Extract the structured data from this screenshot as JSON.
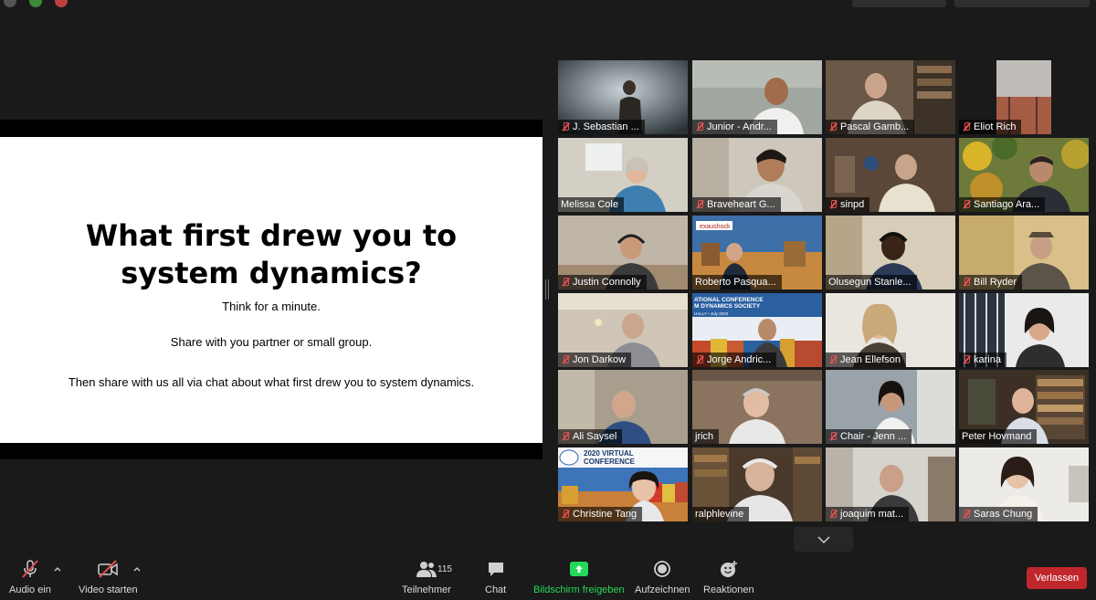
{
  "slide": {
    "title_line1": "What first drew you to",
    "title_line2": "system dynamics?",
    "line1": "Think for a minute.",
    "line2": "Share with you partner or small group.",
    "line3": "Then share with us all via chat about what first drew you to system dynamics."
  },
  "gallery": {
    "participants": [
      {
        "name": "J. Sebastian ...",
        "muted": true
      },
      {
        "name": "Junior - Andr...",
        "muted": true
      },
      {
        "name": "Pascal Gamb...",
        "muted": true
      },
      {
        "name": "Eliot Rich",
        "muted": true
      },
      {
        "name": "Melissa Cole",
        "muted": false
      },
      {
        "name": "Braveheart G...",
        "muted": true
      },
      {
        "name": "sinpd",
        "muted": true
      },
      {
        "name": "Santiago Ara...",
        "muted": true
      },
      {
        "name": "Justin Connolly",
        "muted": true
      },
      {
        "name": "Roberto Pasqua...",
        "muted": false
      },
      {
        "name": "Olusegun Stanle...",
        "muted": false
      },
      {
        "name": "Bill Ryder",
        "muted": true
      },
      {
        "name": "Jon Darkow",
        "muted": true
      },
      {
        "name": "Jorge Andric...",
        "muted": true
      },
      {
        "name": "Jean Ellefson",
        "muted": true
      },
      {
        "name": "karina",
        "muted": true
      },
      {
        "name": "Ali Saysel",
        "muted": true
      },
      {
        "name": "jrich",
        "muted": false
      },
      {
        "name": "Chair - Jenn ...",
        "muted": true
      },
      {
        "name": "Peter Hovmand",
        "muted": false
      },
      {
        "name": "Christine Tang",
        "muted": true
      },
      {
        "name": "ralphlevine",
        "muted": false
      },
      {
        "name": "joaquim mat...",
        "muted": true
      },
      {
        "name": "Saras Chung",
        "muted": true
      }
    ],
    "tile_texts": {
      "roberto_logo": "exaushock",
      "jorge_banner1": "ATIONAL CONFERENCE",
      "jorge_banner2": "M DYNAMICS SOCIETY",
      "jorge_banner3": "UALLY • July 2020",
      "christine_banner1": "2020 VIRTUAL",
      "christine_banner2": "CONFERENCE"
    }
  },
  "toolbar": {
    "audio_label": "Audio ein",
    "video_label": "Video starten",
    "participants_label": "Teilnehmer",
    "participants_count": "115",
    "chat_label": "Chat",
    "share_label": "Bildschirm freigeben",
    "record_label": "Aufzeichnen",
    "reactions_label": "Reaktionen",
    "leave_label": "Verlassen"
  },
  "colors": {
    "background": "#1a1a1a",
    "share_green": "#23d959",
    "leave_red": "#c0272d",
    "mute_red": "#e05050",
    "active_speaker": "#d8d060"
  }
}
